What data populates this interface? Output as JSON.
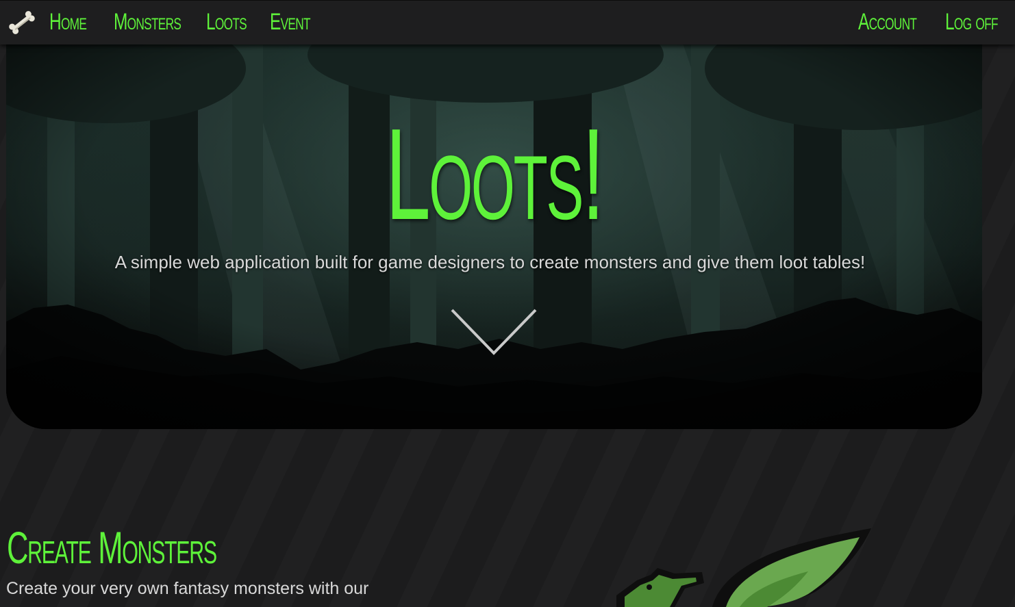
{
  "nav": {
    "links": [
      "Home",
      "Monsters",
      "Loots",
      "Event"
    ],
    "account": "Account",
    "logoff": "Log off",
    "logo_icon": "bone-icon"
  },
  "hero": {
    "title": "Loots!",
    "subtitle": "A simple web application built for game designers to create monsters and give them loot tables!",
    "scroll_icon": "chevron-down-icon"
  },
  "section": {
    "title": "Create Monsters",
    "text": "Create your very own fantasy monsters with our"
  },
  "colors": {
    "accent": "#5ef23a",
    "navbar": "#1e1e1f",
    "background": "#1c1c1d",
    "text": "#d9d9d9"
  }
}
